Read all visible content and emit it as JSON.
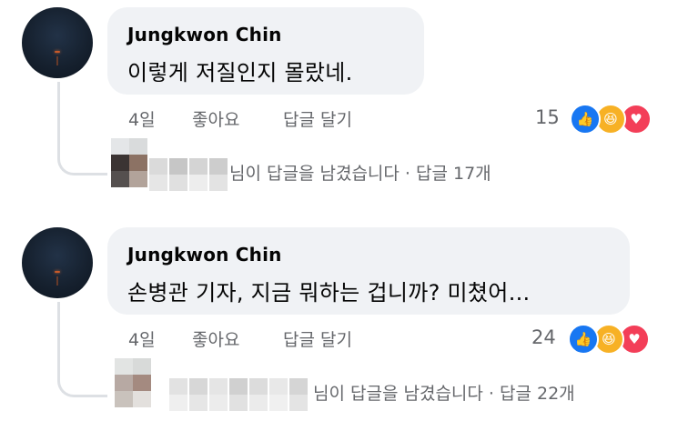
{
  "comments": [
    {
      "author": "Jungkwon Chin",
      "text": "이렇게 저질인지 몰랐네.",
      "time": "4일",
      "like_label": "좋아요",
      "reply_label": "답글 달기",
      "reaction_count": "15",
      "reactions": [
        "like-icon",
        "haha-icon",
        "love-icon"
      ],
      "reply_summary": "님이 답글을 남겼습니다 · 답글 17개"
    },
    {
      "author": "Jungkwon Chin",
      "text": "손병관 기자, 지금 뭐하는 겁니까? 미쳤어...",
      "time": "4일",
      "like_label": "좋아요",
      "reply_label": "답글 달기",
      "reaction_count": "24",
      "reactions": [
        "like-icon",
        "haha-icon",
        "love-icon"
      ],
      "reply_summary": "님이 답글을 남겼습니다 · 답글 22개"
    }
  ],
  "colors": {
    "bubble": "#f0f2f5",
    "meta_text": "#65676b",
    "like": "#1877f2",
    "haha": "#f7b125",
    "love": "#f33e58"
  }
}
